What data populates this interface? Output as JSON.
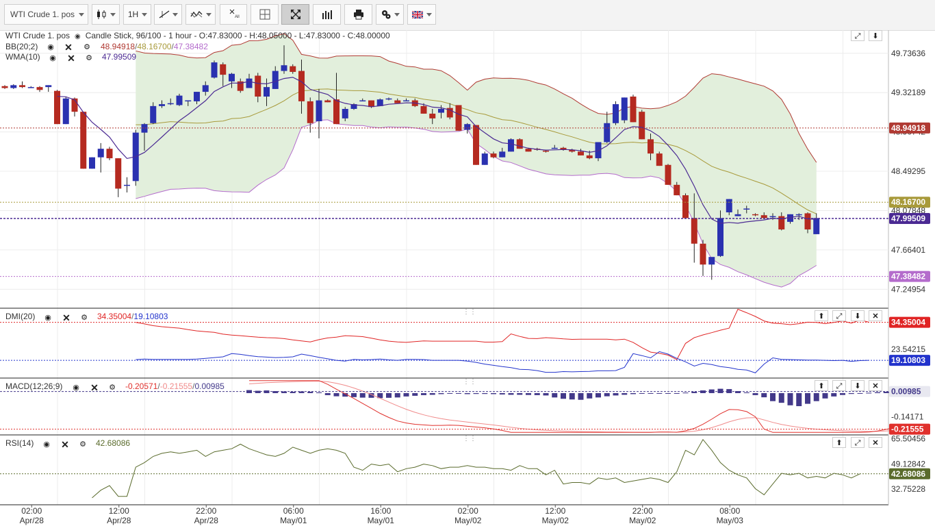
{
  "toolbar": {
    "symbol": "WTI Crude 1. pos",
    "timeframe": "1H",
    "all_label": "All"
  },
  "header": {
    "symbol": "WTI Crude 1. pos",
    "info": "Candle Stick, 96/100 - 1 hour - O:47.83000 - H:48.05000 - L:47.83000 - C:48.00000"
  },
  "indicators": {
    "bb": {
      "name": "BB(20;2)",
      "upper": "48.94918",
      "mid": "48.16700",
      "lower": "47.38482"
    },
    "wma": {
      "name": "WMA(10)",
      "value": "47.99509"
    },
    "dmi": {
      "name": "DMI(20)",
      "plus": "34.35004",
      "minus": "19.10803"
    },
    "macd": {
      "name": "MACD(12;26;9)",
      "macd": "-0.20571",
      "signal": "-0.21555",
      "hist": "0.00985"
    },
    "rsi": {
      "name": "RSI(14)",
      "value": "42.68086"
    }
  },
  "colors": {
    "bull": "#2a31b0",
    "bear": "#b52a20",
    "bb_upper": "#b03a33",
    "bb_mid": "#a89a3a",
    "bb_lower": "#b46ccc",
    "bb_fill": "#e2efdc",
    "wma": "#4b2a93",
    "dmi_plus": "#e02424",
    "dmi_minus": "#2233cc",
    "macd_line": "#e0302c",
    "signal_line": "#f08a8a",
    "hist": "#43398a",
    "rsi": "#5a6b2c"
  },
  "chart_data": [
    {
      "type": "candlestick",
      "title": "WTI Crude 1. pos",
      "y_ticks": [
        49.73636,
        49.32189,
        48.90742,
        48.49295,
        48.07848,
        47.66401,
        47.24954
      ],
      "ylim": [
        47.05,
        49.98
      ],
      "x_ticks": [
        {
          "i": 3,
          "time": "02:00",
          "date": "Apr/28"
        },
        {
          "i": 13,
          "time": "12:00",
          "date": "Apr/28"
        },
        {
          "i": 23,
          "time": "22:00",
          "date": "Apr/28"
        },
        {
          "i": 33,
          "time": "06:00",
          "date": "May/01"
        },
        {
          "i": 43,
          "time": "16:00",
          "date": "May/01"
        },
        {
          "i": 53,
          "time": "02:00",
          "date": "May/02"
        },
        {
          "i": 63,
          "time": "12:00",
          "date": "May/02"
        },
        {
          "i": 73,
          "time": "22:00",
          "date": "May/02"
        },
        {
          "i": 83,
          "time": "08:00",
          "date": "May/03"
        }
      ],
      "price_tags": [
        {
          "value": 48.94918,
          "text": "48.94918",
          "color": "#b03a33"
        },
        {
          "value": 48.167,
          "text": "48.16700",
          "color": "#a89a3a"
        },
        {
          "value": 47.99509,
          "text": "47.99509",
          "color": "#4b2a93"
        },
        {
          "value": 47.38482,
          "text": "47.38482",
          "color": "#b46ccc"
        }
      ],
      "candles": [
        [
          49.39,
          49.4,
          49.36,
          49.37
        ],
        [
          49.37,
          49.41,
          49.36,
          49.4
        ],
        [
          49.4,
          49.44,
          49.37,
          49.38
        ],
        [
          49.38,
          49.39,
          49.37,
          49.38
        ],
        [
          49.38,
          49.39,
          49.33,
          49.35
        ],
        [
          49.38,
          49.4,
          49.33,
          49.4
        ],
        [
          49.34,
          49.35,
          48.99,
          48.99
        ],
        [
          48.99,
          49.28,
          48.99,
          49.26
        ],
        [
          49.26,
          49.27,
          49.07,
          49.12
        ],
        [
          49.12,
          49.12,
          48.52,
          48.52
        ],
        [
          48.52,
          48.64,
          48.52,
          48.64
        ],
        [
          48.64,
          48.79,
          48.48,
          48.73
        ],
        [
          48.73,
          48.75,
          48.61,
          48.63
        ],
        [
          48.63,
          48.63,
          48.22,
          48.31
        ],
        [
          48.34,
          48.43,
          48.27,
          48.35
        ],
        [
          48.39,
          48.93,
          48.34,
          48.9
        ],
        [
          48.9,
          49.0,
          48.71,
          48.99
        ],
        [
          49.0,
          49.22,
          48.99,
          49.18
        ],
        [
          49.18,
          49.24,
          49.16,
          49.2
        ],
        [
          49.2,
          49.26,
          49.19,
          49.21
        ],
        [
          49.19,
          49.31,
          49.18,
          49.29
        ],
        [
          49.23,
          49.24,
          49.18,
          49.24
        ],
        [
          49.23,
          49.33,
          49.2,
          49.33
        ],
        [
          49.33,
          49.44,
          49.29,
          49.4
        ],
        [
          49.48,
          49.66,
          49.47,
          49.64
        ],
        [
          49.62,
          49.64,
          49.39,
          49.51
        ],
        [
          49.44,
          49.53,
          49.37,
          49.52
        ],
        [
          49.44,
          49.47,
          49.32,
          49.34
        ],
        [
          49.37,
          49.52,
          49.37,
          49.47
        ],
        [
          49.5,
          49.53,
          49.22,
          49.28
        ],
        [
          49.28,
          49.47,
          49.18,
          49.38
        ],
        [
          49.36,
          49.6,
          49.36,
          49.55
        ],
        [
          49.55,
          49.82,
          49.52,
          49.61
        ],
        [
          49.6,
          49.62,
          49.52,
          49.54
        ],
        [
          49.55,
          49.67,
          49.1,
          49.23
        ],
        [
          49.23,
          49.27,
          48.9,
          49.0
        ],
        [
          49.02,
          49.36,
          48.84,
          49.24
        ],
        [
          49.24,
          49.25,
          49.22,
          49.22
        ],
        [
          49.25,
          49.53,
          48.99,
          48.99
        ],
        [
          49.05,
          49.17,
          49.02,
          49.15
        ],
        [
          49.15,
          49.21,
          49.14,
          49.2
        ],
        [
          49.24,
          49.26,
          49.23,
          49.24
        ],
        [
          49.24,
          49.24,
          49.16,
          49.17
        ],
        [
          49.18,
          49.26,
          49.18,
          49.25
        ],
        [
          49.25,
          49.27,
          49.24,
          49.26
        ],
        [
          49.24,
          49.26,
          49.21,
          49.21
        ],
        [
          49.24,
          49.26,
          49.23,
          49.24
        ],
        [
          49.24,
          49.26,
          49.17,
          49.18
        ],
        [
          49.18,
          49.21,
          49.1,
          49.1
        ],
        [
          49.1,
          49.15,
          48.99,
          49.05
        ],
        [
          49.11,
          49.19,
          49.05,
          49.15
        ],
        [
          49.16,
          49.21,
          49.04,
          49.06
        ],
        [
          49.19,
          49.19,
          48.92,
          48.92
        ],
        [
          48.93,
          49.0,
          48.89,
          48.99
        ],
        [
          48.98,
          48.98,
          48.56,
          48.56
        ],
        [
          48.56,
          48.7,
          48.56,
          48.68
        ],
        [
          48.68,
          48.7,
          48.63,
          48.64
        ],
        [
          48.64,
          48.74,
          48.64,
          48.7
        ],
        [
          48.7,
          48.84,
          48.7,
          48.83
        ],
        [
          48.83,
          48.84,
          48.73,
          48.73
        ],
        [
          48.73,
          48.74,
          48.7,
          48.7
        ],
        [
          48.73,
          48.74,
          48.71,
          48.72
        ],
        [
          48.71,
          48.72,
          48.69,
          48.7
        ],
        [
          48.74,
          48.77,
          48.73,
          48.74
        ],
        [
          48.74,
          48.75,
          48.71,
          48.72
        ],
        [
          48.72,
          48.73,
          48.69,
          48.7
        ],
        [
          48.7,
          48.73,
          48.66,
          48.66
        ],
        [
          48.66,
          48.71,
          48.62,
          48.63
        ],
        [
          48.63,
          48.8,
          48.6,
          48.8
        ],
        [
          48.8,
          49.12,
          48.79,
          49.0
        ],
        [
          49.0,
          49.23,
          48.98,
          49.2
        ],
        [
          49.03,
          49.27,
          49.0,
          49.27
        ],
        [
          49.28,
          49.3,
          49.01,
          49.01
        ],
        [
          49.12,
          49.14,
          48.83,
          48.83
        ],
        [
          48.83,
          48.89,
          48.61,
          48.68
        ],
        [
          48.68,
          48.7,
          48.55,
          48.55
        ],
        [
          48.56,
          48.57,
          48.35,
          48.35
        ],
        [
          48.35,
          48.38,
          48.24,
          48.24
        ],
        [
          48.24,
          48.26,
          48.0,
          48.0
        ],
        [
          48.0,
          48.26,
          47.53,
          47.73
        ],
        [
          47.73,
          47.77,
          47.39,
          47.51
        ],
        [
          47.51,
          47.52,
          47.35,
          47.59
        ],
        [
          47.6,
          48.08,
          47.59,
          48.0
        ],
        [
          48.06,
          48.2,
          48.03,
          48.2
        ],
        [
          48.02,
          48.09,
          48.02,
          48.04
        ],
        [
          48.09,
          48.13,
          48.05,
          48.1
        ],
        [
          48.04,
          48.05,
          48.02,
          48.03
        ],
        [
          48.03,
          48.06,
          47.99,
          48.0
        ],
        [
          48.02,
          48.05,
          47.98,
          48.02
        ],
        [
          48.02,
          48.06,
          47.87,
          47.88
        ],
        [
          47.96,
          48.04,
          47.94,
          48.04
        ],
        [
          48.04,
          48.05,
          47.98,
          48.04
        ],
        [
          48.05,
          48.06,
          47.84,
          47.88
        ],
        [
          47.83,
          48.05,
          47.83,
          48.0
        ]
      ]
    },
    {
      "type": "line",
      "title": "DMI(20)",
      "y_ticks": [
        23.54215
      ],
      "ylim": [
        12,
        40
      ],
      "series": [
        {
          "name": "+DI",
          "color": "#e02424",
          "start": 15,
          "values": [
            34.3,
            33.7,
            33.0,
            32.6,
            32.3,
            32.0,
            31.4,
            30.9,
            30.6,
            30.3,
            29.6,
            29.2,
            29.0,
            28.7,
            28.4,
            28.2,
            28.1,
            27.8,
            27.3,
            26.9,
            26.5,
            27.4,
            28.1,
            28.4,
            29.0,
            28.8,
            28.6,
            28.0,
            27.3,
            26.8,
            26.5,
            26.3,
            26.6,
            26.9,
            26.8,
            26.8,
            26.8,
            26.8,
            26.8,
            26.8,
            26.4,
            26.4,
            26.6,
            29.7,
            28.7,
            27.9,
            27.8,
            28.2,
            28.0,
            27.7,
            27.5,
            27.6,
            27.6,
            27.6,
            27.6,
            27.3,
            27.6,
            26.3,
            24.2,
            22.4,
            21.9,
            21.2,
            19.4,
            25.9,
            28.2,
            29.3,
            30.2,
            31.2,
            32.0,
            39.6,
            38.2,
            36.7,
            34.9,
            34.0,
            33.8,
            33.4,
            33.8,
            34.4,
            34.3,
            33.8,
            34.3,
            34.9,
            34.0,
            35.3,
            34.4
          ]
        },
        {
          "name": "-DI",
          "color": "#2233cc",
          "start": 15,
          "values": [
            19.4,
            19.6,
            19.5,
            19.5,
            19.5,
            19.5,
            19.5,
            19.6,
            19.9,
            20.2,
            20.5,
            21.8,
            21.5,
            21.0,
            20.6,
            20.4,
            20.2,
            20.3,
            20.5,
            21.6,
            21.0,
            20.3,
            19.7,
            19.1,
            18.8,
            19.5,
            19.3,
            19.4,
            19.6,
            19.3,
            19.1,
            19.5,
            19.5,
            19.4,
            19.1,
            19.1,
            19.1,
            19.1,
            18.8,
            18.3,
            17.6,
            17.1,
            16.6,
            16.2,
            15.5,
            15.4,
            15.0,
            14.3,
            14.3,
            14.6,
            14.5,
            14.6,
            14.7,
            14.9,
            14.9,
            15.0,
            16.3,
            21.8,
            21.0,
            20.1,
            22.6,
            21.6,
            19.9,
            18.5,
            16.8,
            17.9,
            17.4,
            16.6,
            16.2,
            15.5,
            15.2,
            14.1,
            17.6,
            20.1,
            19.5,
            19.4,
            19.3,
            19.2,
            19.2,
            19.1,
            19.0,
            19.1,
            18.7,
            19.0,
            19.1
          ]
        }
      ]
    },
    {
      "type": "bar",
      "title": "MACD(12;26;9)",
      "y_ticks": [
        -0.14171
      ],
      "ylim": [
        -0.25,
        0.09
      ],
      "hist_start": 28,
      "hist": [
        0.018,
        0.014,
        0.016,
        0.012,
        0.01,
        0.008,
        0.01,
        0.008,
        0.004,
        -0.012,
        -0.019,
        -0.021,
        -0.024,
        -0.027,
        -0.028,
        -0.03,
        -0.028,
        -0.026,
        -0.02,
        -0.016,
        -0.012,
        -0.01,
        -0.006,
        -0.004,
        -0.004,
        -0.006,
        -0.005,
        -0.005,
        -0.006,
        -0.008,
        -0.01,
        -0.01,
        -0.011,
        -0.012,
        -0.014,
        -0.026,
        -0.034,
        -0.038,
        -0.04,
        -0.032,
        -0.026,
        -0.019,
        -0.014,
        -0.01,
        -0.006,
        -0.003,
        -0.002,
        -0.001,
        -0.002,
        -0.003,
        0.003,
        0.008,
        0.016,
        0.022,
        0.026,
        0.024,
        0.012,
        0.004,
        -0.012,
        -0.025,
        -0.048,
        -0.058,
        -0.073,
        -0.078,
        -0.064,
        -0.048,
        -0.032,
        -0.02,
        -0.011,
        -0.005,
        -0.001,
        0.002,
        0.005,
        0.008,
        0.01
      ]
    },
    {
      "type": "line",
      "title": "RSI(14)",
      "y_ticks": [
        65.50456,
        49.12842,
        32.75228
      ],
      "ylim": [
        22.5,
        68
      ],
      "series": [
        {
          "name": "RSI",
          "color": "#5a6b2c",
          "start": 10,
          "values": [
            27,
            32,
            35,
            28,
            28,
            47,
            50,
            54,
            56,
            57,
            56,
            57,
            58,
            54,
            57,
            58,
            59,
            62,
            59,
            57,
            55,
            54,
            56,
            60,
            58,
            56,
            58,
            59,
            58,
            56,
            47,
            45,
            49,
            48,
            49,
            44,
            46,
            47,
            49,
            48,
            46,
            47,
            47,
            48,
            47,
            47,
            46,
            46,
            45,
            48,
            46,
            46,
            42,
            45,
            36,
            37,
            37,
            36,
            40,
            39,
            40,
            37,
            38,
            39,
            40,
            39,
            37,
            44,
            58,
            55,
            65,
            58,
            50,
            45,
            42,
            40,
            33,
            29,
            36,
            43,
            42,
            43,
            40,
            41,
            40,
            43,
            42,
            40,
            42.68
          ]
        }
      ]
    }
  ]
}
